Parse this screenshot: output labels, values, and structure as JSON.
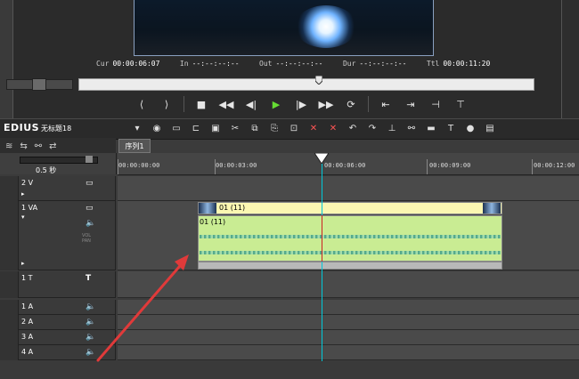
{
  "recorder": {
    "cur_label": "Cur",
    "cur_value": "00:00:06:07",
    "in_label": "In",
    "in_value": "--:--:--:--",
    "out_label": "Out",
    "out_value": "--:--:--:--",
    "dur_label": "Dur",
    "dur_value": "--:--:--:--",
    "ttl_label": "Ttl",
    "ttl_value": "00:00:11:20"
  },
  "app": {
    "logo": "EDIUS",
    "project_name": "无标题18"
  },
  "timeline": {
    "sequence_tab": "序列1",
    "zoom_label": "0.5 秒",
    "ruler_ticks": [
      "00:00:00:00",
      "00:00:03:00",
      "00:00:06:00",
      "00:00:09:00",
      "00:00:12:00"
    ],
    "tracks": [
      {
        "name": "2 V",
        "type": "video"
      },
      {
        "name": "1 VA",
        "type": "video-audio"
      },
      {
        "name": "1 T",
        "type": "title"
      },
      {
        "name": "1 A",
        "type": "audio"
      },
      {
        "name": "2 A",
        "type": "audio"
      },
      {
        "name": "3 A",
        "type": "audio"
      },
      {
        "name": "4 A",
        "type": "audio"
      }
    ],
    "clip": {
      "video_label": "01 (11)",
      "audio_label": "01 (11)"
    },
    "vol_label": "VOL\nPAN"
  },
  "colors": {
    "clip_video": "#fbf7b2",
    "clip_audio": "#c9ec93",
    "playhead": "#00c8d8",
    "annotation_arrow": "#e03a3a"
  }
}
